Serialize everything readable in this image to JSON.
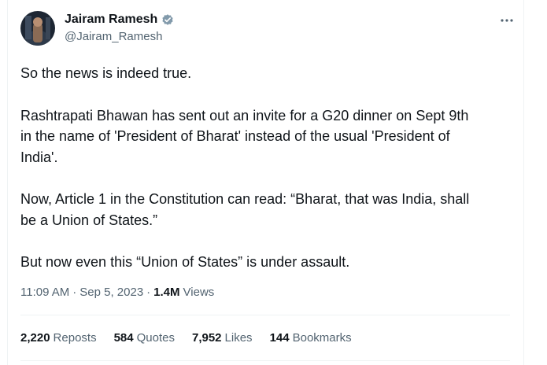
{
  "author": {
    "name": "Jairam Ramesh",
    "handle": "@Jairam_Ramesh",
    "verified_color": "#829aab"
  },
  "tweet": {
    "paragraphs": [
      "So the news is indeed true.",
      "Rashtrapati Bhawan has sent out an invite for a G20 dinner on Sept 9th\nin the name of 'President of Bharat' instead of the usual 'President of\nIndia'.",
      "Now, Article 1 in the Constitution can read: “Bharat, that was India, shall\nbe a Union of States.”",
      "But now even this “Union of States” is under assault."
    ],
    "time": "11:09 AM",
    "sep1": "·",
    "date": "Sep 5, 2023",
    "sep2": "·",
    "views_count": "1.4M",
    "views_label": "Views"
  },
  "stats": {
    "reposts_count": "2,220",
    "reposts_label": "Reposts",
    "quotes_count": "584",
    "quotes_label": "Quotes",
    "likes_count": "7,952",
    "likes_label": "Likes",
    "bookmarks_count": "144",
    "bookmarks_label": "Bookmarks"
  },
  "icons": {
    "more": "more-horizontal-icon",
    "verified": "verified-badge-icon"
  },
  "colors": {
    "text": "#0f1419",
    "secondary": "#536471",
    "divider": "#eff3f4"
  }
}
